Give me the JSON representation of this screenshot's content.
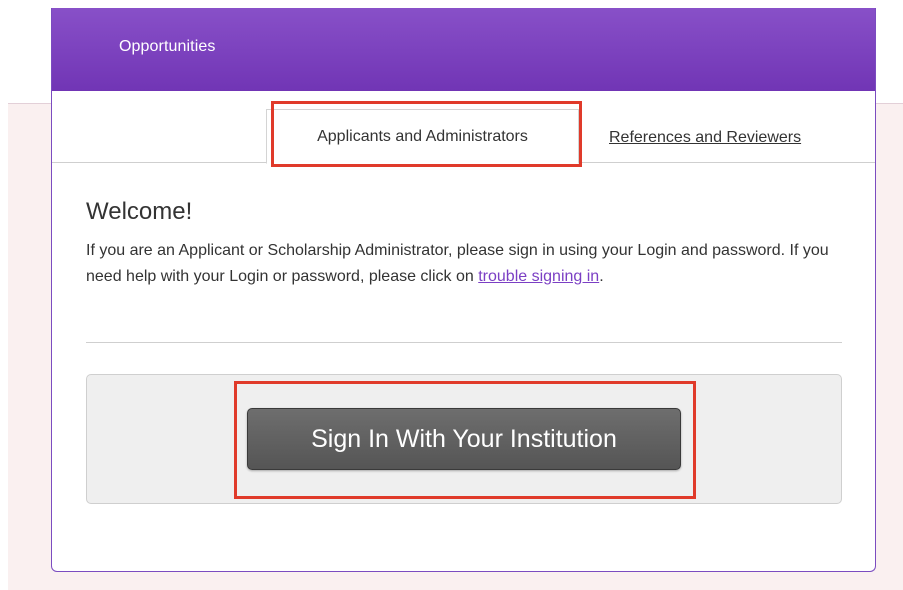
{
  "header": {
    "title": "Opportunities",
    "gradient_top": "#8850c8",
    "gradient_bottom": "#7135b5"
  },
  "tabs": [
    {
      "label": "Applicants and Administrators",
      "active": true
    },
    {
      "label": "References and Reviewers",
      "active": false
    }
  ],
  "welcome": {
    "heading": "Welcome!",
    "text_before_link": "If you are an Applicant or Scholarship Administrator, please sign in using your Login and password. If you need help with your Login or password, please click on ",
    "link_text": "trouble signing in",
    "text_after_link": "."
  },
  "signin": {
    "button_label": "Sign In With Your Institution"
  },
  "colors": {
    "accent_purple": "#7b3fc4",
    "highlight_red": "#e03a2a",
    "page_tint": "#faf0f0"
  }
}
